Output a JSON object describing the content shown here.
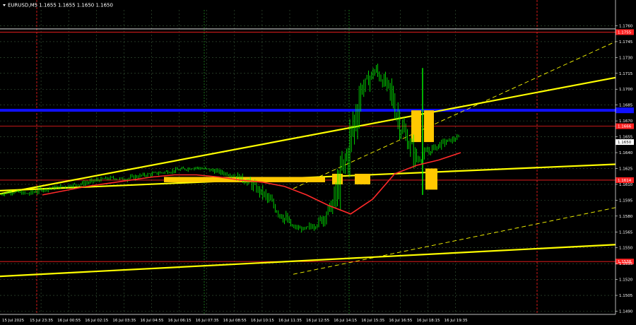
{
  "chart_data": {
    "type": "candlestick",
    "title": "EURUSD,M5  1.1655 1.1655 1.1650 1.1650",
    "ylim": [
      1.1487,
      1.1775
    ],
    "y_ticks": [
      "1.1760",
      "1.1745",
      "1.1730",
      "1.1715",
      "1.1700",
      "1.1685",
      "1.1670",
      "1.1655",
      "1.1640",
      "1.1625",
      "1.1610",
      "1.1595",
      "1.1580",
      "1.1565",
      "1.1550",
      "1.1535",
      "1.1520",
      "1.1505",
      "1.1490"
    ],
    "x_ticks": [
      "15 Jul 2025",
      "15 Jul 23:35",
      "16 Jul 00:55",
      "16 Jul 02:15",
      "16 Jul 03:35",
      "16 Jul 04:55",
      "16 Jul 06:15",
      "16 Jul 07:35",
      "16 Jul 08:55",
      "16 Jul 10:15",
      "16 Jul 11:35",
      "16 Jul 12:55",
      "16 Jul 14:15",
      "16 Jul 15:35",
      "16 Jul 16:55",
      "16 Jul 18:15",
      "16 Jul 19:35"
    ],
    "price_path": [
      1.1601,
      1.1603,
      1.1601,
      1.1605,
      1.1607,
      1.1609,
      1.1611,
      1.1614,
      1.1616,
      1.1615,
      1.1618,
      1.162,
      1.1622,
      1.1624,
      1.1626,
      1.1624,
      1.1621,
      1.1618,
      1.1611,
      1.16,
      1.1585,
      1.157,
      1.1567,
      1.1575,
      1.1592,
      1.164,
      1.17,
      1.1718,
      1.17,
      1.166,
      1.1633,
      1.1643,
      1.165,
      1.1654
    ],
    "ma_path": [
      1.16,
      1.1604,
      1.1608,
      1.1611,
      1.1614,
      1.1617,
      1.1619,
      1.1619,
      1.1617,
      1.1614,
      1.1612,
      1.1608,
      1.16,
      1.159,
      1.1582,
      1.1596,
      1.162,
      1.1628,
      1.1633,
      1.164
    ],
    "levels": {
      "blue_line": 1.168,
      "red_levels": [
        {
          "value": 1.1754,
          "label": "1.1755"
        },
        {
          "value": 1.1665,
          "label": "1.1666"
        },
        {
          "value": 1.1614,
          "label": "1.1614"
        },
        {
          "value": 1.1537,
          "label": "1.1538"
        }
      ],
      "white_level": 1.1757,
      "current_price": {
        "value": 1.165,
        "label": "1.1650"
      }
    },
    "trend_lines": [
      {
        "style": "solid",
        "from": 1.1601,
        "to": 1.1711
      },
      {
        "style": "solid",
        "from": 1.1523,
        "to": 1.1553
      },
      {
        "style": "solid",
        "from": 1.1604,
        "to": 1.1629
      },
      {
        "style": "dashed",
        "from": 1.1606,
        "to": 1.1745
      },
      {
        "style": "dashed",
        "from": 1.1525,
        "to": 1.1588
      }
    ],
    "signal_boxes": [
      {
        "time": "16 Jul 06:15"
      },
      {
        "time": "16 Jul 14:15"
      },
      {
        "time": "16 Jul 15:35"
      },
      {
        "time": "16 Jul 18:15"
      },
      {
        "time": "16 Jul 18:15"
      },
      {
        "time": "16 Jul 18:15"
      }
    ],
    "colors": {
      "background": "#000000",
      "candles": "#00ff00",
      "moving_average": "#ff2a2a",
      "trend_lines": "#ffff00",
      "blue_line": "#1010ff",
      "red_levels": "#ff2020",
      "signal_boxes": "#ffc800",
      "grid": "#3a5a3a"
    },
    "grid": true
  }
}
